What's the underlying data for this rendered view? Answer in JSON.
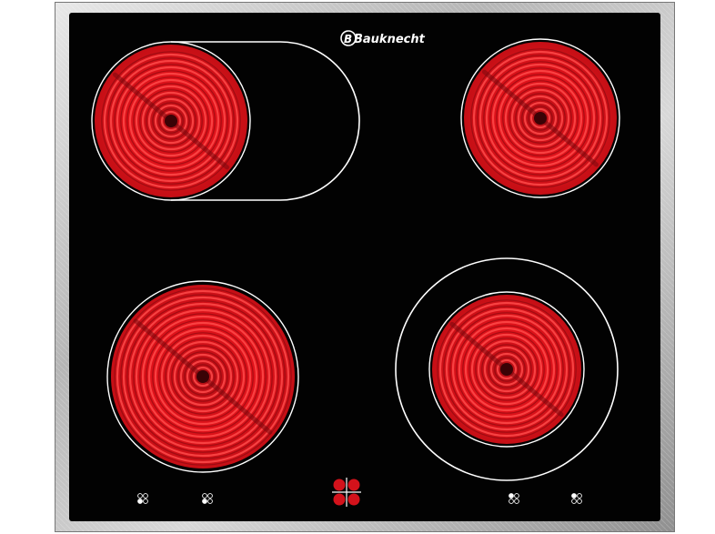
{
  "product": {
    "brand": "Bauknecht",
    "kind": "ceramic-glass-cooktop"
  },
  "colors": {
    "glass": "#020202",
    "frame_light": "#e6e6e6",
    "frame_mid": "#b8b8b8",
    "frame_dark": "#8e8e8e",
    "zone_red": "#e0121a",
    "zone_dark": "#7a0a0f",
    "zone_line": "#ffffff",
    "coil_line": "#ff4a4a"
  },
  "zones": [
    {
      "id": "rear-left",
      "type": "dual-extended",
      "state": "on"
    },
    {
      "id": "rear-right",
      "type": "single",
      "state": "on"
    },
    {
      "id": "front-left",
      "type": "single-large",
      "state": "on"
    },
    {
      "id": "front-right",
      "type": "dual-ring",
      "state": "on"
    }
  ],
  "indicators": [
    {
      "id": "front-left-outer",
      "icon": "zone-position-icon"
    },
    {
      "id": "front-left-inner",
      "icon": "zone-position-icon"
    },
    {
      "id": "center-hot-surface",
      "icon": "hot-surface-indicator-icon"
    },
    {
      "id": "front-right-inner",
      "icon": "zone-position-icon"
    },
    {
      "id": "front-right-outer",
      "icon": "zone-position-icon"
    }
  ]
}
